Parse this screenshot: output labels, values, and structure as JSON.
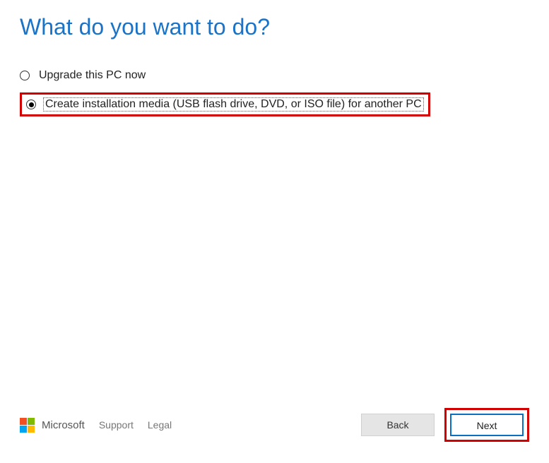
{
  "title": "What do you want to do?",
  "options": {
    "upgrade": {
      "label": "Upgrade this PC now",
      "selected": false
    },
    "create": {
      "label": "Create installation media (USB flash drive, DVD, or ISO file) for another PC",
      "selected": true
    }
  },
  "footer": {
    "brand": "Microsoft",
    "support": "Support",
    "legal": "Legal"
  },
  "buttons": {
    "back": "Back",
    "next": "Next"
  }
}
